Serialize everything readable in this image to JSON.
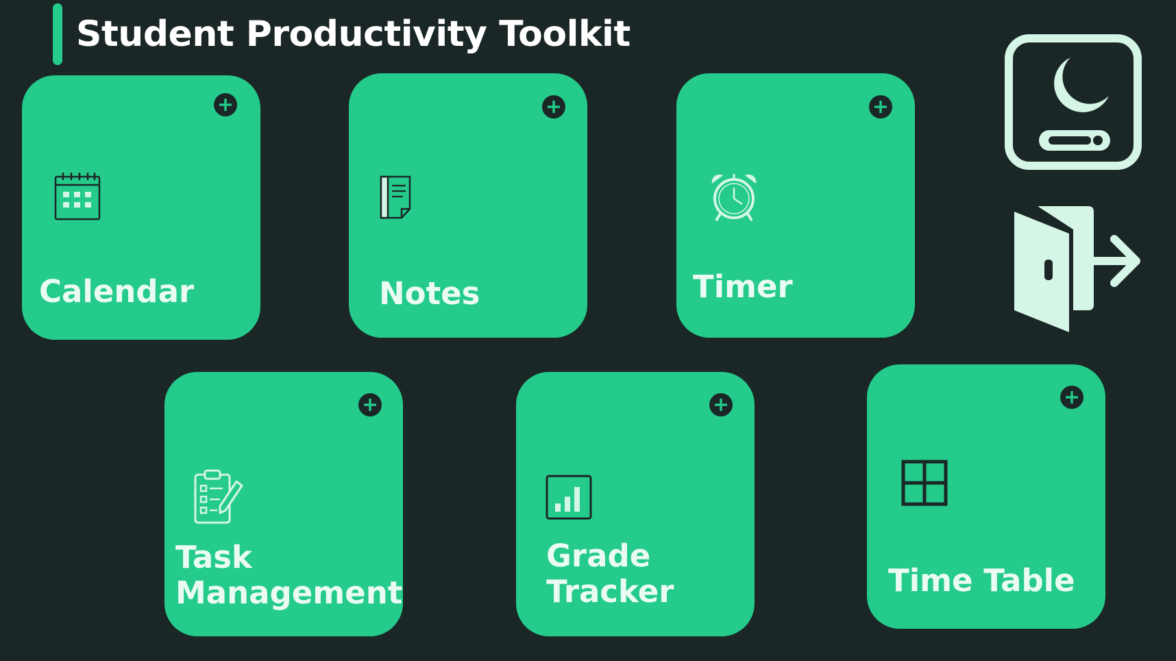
{
  "header": {
    "title": "Student Productivity Toolkit"
  },
  "colors": {
    "background": "#1b2627",
    "accent": "#24cb8a",
    "label": "#eafbf3",
    "icon_dark": "#1b2627",
    "icon_light": "#d5f6e6"
  },
  "tiles": [
    {
      "label_lines": [
        "Calendar"
      ],
      "icon": "calendar-icon",
      "action_icon": "add-circle-icon"
    },
    {
      "label_lines": [
        "Notes"
      ],
      "icon": "notes-icon",
      "action_icon": "add-circle-icon"
    },
    {
      "label_lines": [
        "Timer"
      ],
      "icon": "alarm-clock-icon",
      "action_icon": "add-circle-icon"
    },
    {
      "label_lines": [
        "Task",
        "Management"
      ],
      "icon": "checklist-icon",
      "action_icon": "add-circle-icon"
    },
    {
      "label_lines": [
        "Grade",
        "Tracker"
      ],
      "icon": "bar-chart-icon",
      "action_icon": "add-circle-icon"
    },
    {
      "label_lines": [
        "Time Table"
      ],
      "icon": "grid-table-icon",
      "action_icon": "add-circle-icon"
    }
  ],
  "side_actions": [
    {
      "icon": "dark-mode-toggle-icon"
    },
    {
      "icon": "logout-door-icon"
    }
  ]
}
